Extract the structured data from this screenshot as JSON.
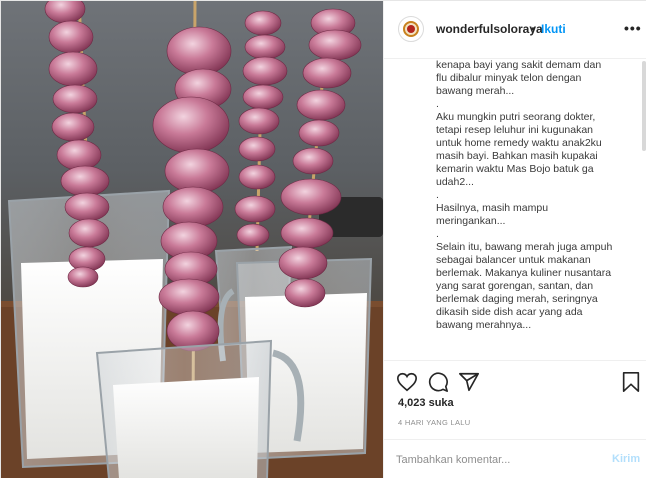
{
  "header": {
    "username": "wonderfulsoloraya",
    "separator": "•",
    "follow_label": "Ikuti",
    "more_label": "•••"
  },
  "caption": {
    "text": "kenapa bayi yang sakit demam dan\nflu dibalur minyak telon dengan\nbawang merah...\n.\nAku mungkin putri seorang dokter,\ntetapi resep leluhur ini kugunakan\nuntuk home remedy waktu anak2ku\nmasih bayi. Bahkan masih kupakai\nkemarin waktu Mas Bojo batuk ga\nudah2...\n.\nHasilnya, masih mampu\nmeringankan...\n.\nSelain itu, bawang merah juga ampuh\nsebagai balancer untuk makanan\nberlemak. Makanya kuliner nusantara\nyang sarat gorengan, santan, dan\nberlemak daging merah, seringnya\ndikasih side dish acar yang ada\nbawang merahnya..."
  },
  "actions": {
    "like_icon": "heart-icon",
    "comment_icon": "comment-icon",
    "share_icon": "share-icon",
    "save_icon": "bookmark-icon"
  },
  "likes": {
    "text": "4,023 suka"
  },
  "time": {
    "text": "4 HARI YANG LALU"
  },
  "comment": {
    "placeholder": "Tambahkan komentar...",
    "post_label": "Kirim"
  },
  "colors": {
    "accent": "#0095f6",
    "post_disabled": "#b2dffc",
    "text": "#262626",
    "muted": "#8e8e8e",
    "onion": "#a8536f"
  }
}
